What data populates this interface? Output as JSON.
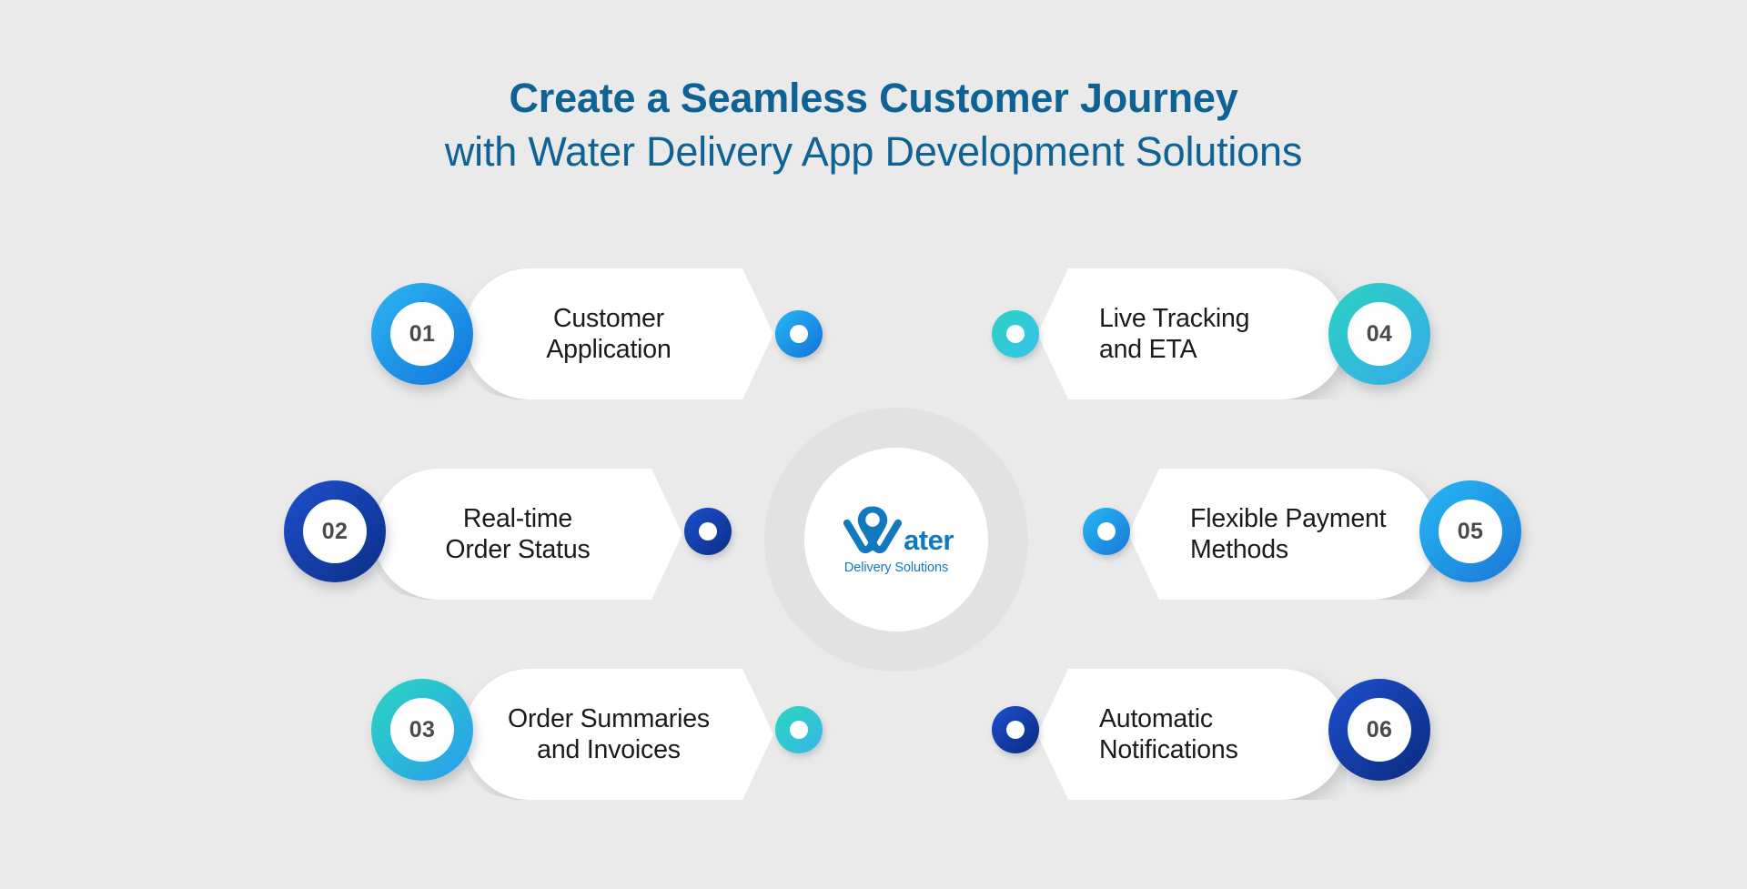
{
  "page": {
    "background_color": "#eaeaea",
    "title_line1": "Create a Seamless Customer Journey",
    "title_line2": "with Water Delivery App Development Solutions",
    "title_color": "#0e6394"
  },
  "center_logo": {
    "word": "ater",
    "tagline": "Delivery Solutions",
    "brand_color": "#1379be",
    "mark_name": "water-drop-w-pin-logo"
  },
  "cards": [
    {
      "number": "01",
      "label_line1": "Customer",
      "label_line2": "Application",
      "side": "left",
      "ring_gradient_from": "#2cb6f0",
      "ring_gradient_to": "#1274dd",
      "dot_gradient_from": "#25b8f5",
      "dot_gradient_to": "#1472d8"
    },
    {
      "number": "02",
      "label_line1": "Real-time",
      "label_line2": "Order Status",
      "side": "left",
      "ring_gradient_from": "#1d4fcd",
      "ring_gradient_to": "#0c2f86",
      "dot_gradient_from": "#1d4fcd",
      "dot_gradient_to": "#0c2f86"
    },
    {
      "number": "03",
      "label_line1": "Order Summaries",
      "label_line2": "and Invoices",
      "side": "left",
      "ring_gradient_from": "#2bd6c0",
      "ring_gradient_to": "#2a9cef",
      "dot_gradient_from": "#2bd6c0",
      "dot_gradient_to": "#39b6e8"
    },
    {
      "number": "04",
      "label_line1": "Live Tracking",
      "label_line2": "and ETA",
      "side": "right",
      "ring_gradient_from": "#2cd3c2",
      "ring_gradient_to": "#36a9ea",
      "dot_gradient_from": "#2cd3c2",
      "dot_gradient_to": "#36c2ea"
    },
    {
      "number": "05",
      "label_line1": "Flexible Payment",
      "label_line2": "Methods",
      "side": "right",
      "ring_gradient_from": "#26b9f4",
      "ring_gradient_to": "#1a76d6",
      "dot_gradient_from": "#26b9f4",
      "dot_gradient_to": "#1a76d6"
    },
    {
      "number": "06",
      "label_line1": "Automatic",
      "label_line2": "Notifications",
      "side": "right",
      "ring_gradient_from": "#1d50ce",
      "ring_gradient_to": "#0b2a7d",
      "dot_gradient_from": "#1d50ce",
      "dot_gradient_to": "#0b2a7d"
    }
  ]
}
